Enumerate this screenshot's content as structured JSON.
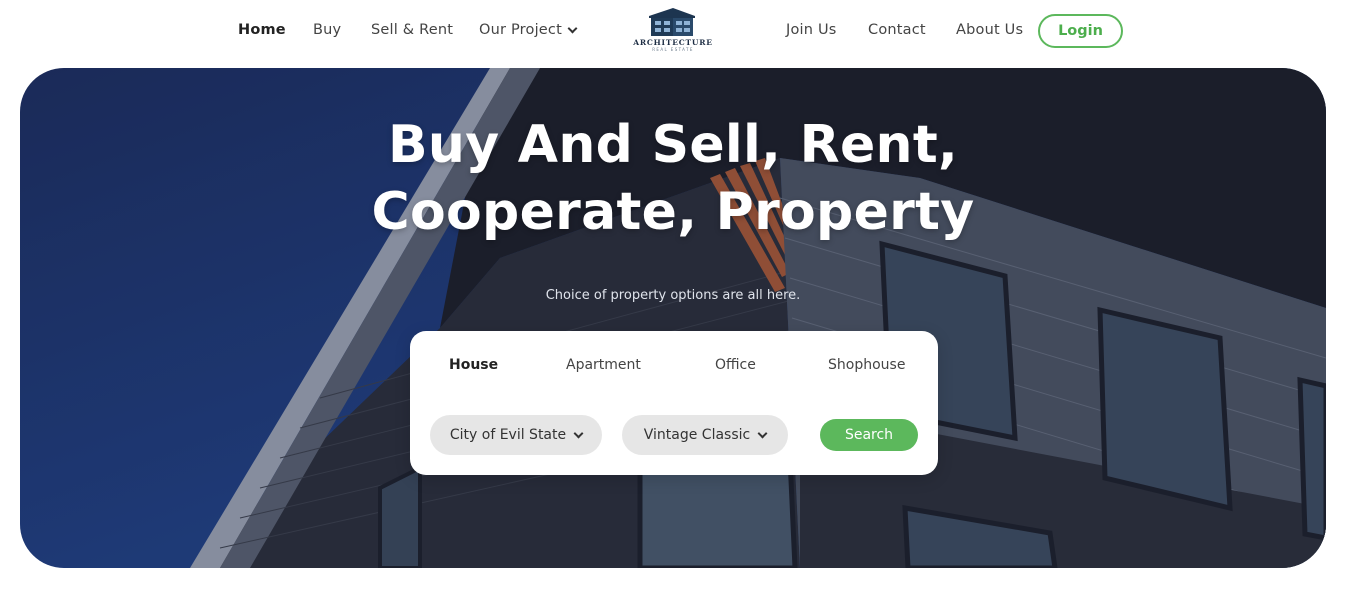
{
  "nav": {
    "home": "Home",
    "buy": "Buy",
    "sell_rent": "Sell & Rent",
    "our_project": "Our Project",
    "join_us": "Join Us",
    "contact": "Contact",
    "about_us": "About Us",
    "login": "Login"
  },
  "logo": {
    "name": "ARCHITECTURE",
    "tagline": "REAL ESTATE",
    "icon": "building-logo-icon"
  },
  "hero": {
    "title_line1": "Buy And Sell, Rent,",
    "title_line2": "Cooperate, Property",
    "subtitle": "Choice of property options are all here."
  },
  "search": {
    "tabs": [
      {
        "label": "House",
        "active": true
      },
      {
        "label": "Apartment",
        "active": false
      },
      {
        "label": "Office",
        "active": false
      },
      {
        "label": "Shophouse",
        "active": false
      }
    ],
    "location": "City of Evil State",
    "style": "Vintage Classic",
    "button": "Search"
  },
  "colors": {
    "accent_green": "#5cb85c",
    "hero_blue": "#1f3d7c"
  }
}
